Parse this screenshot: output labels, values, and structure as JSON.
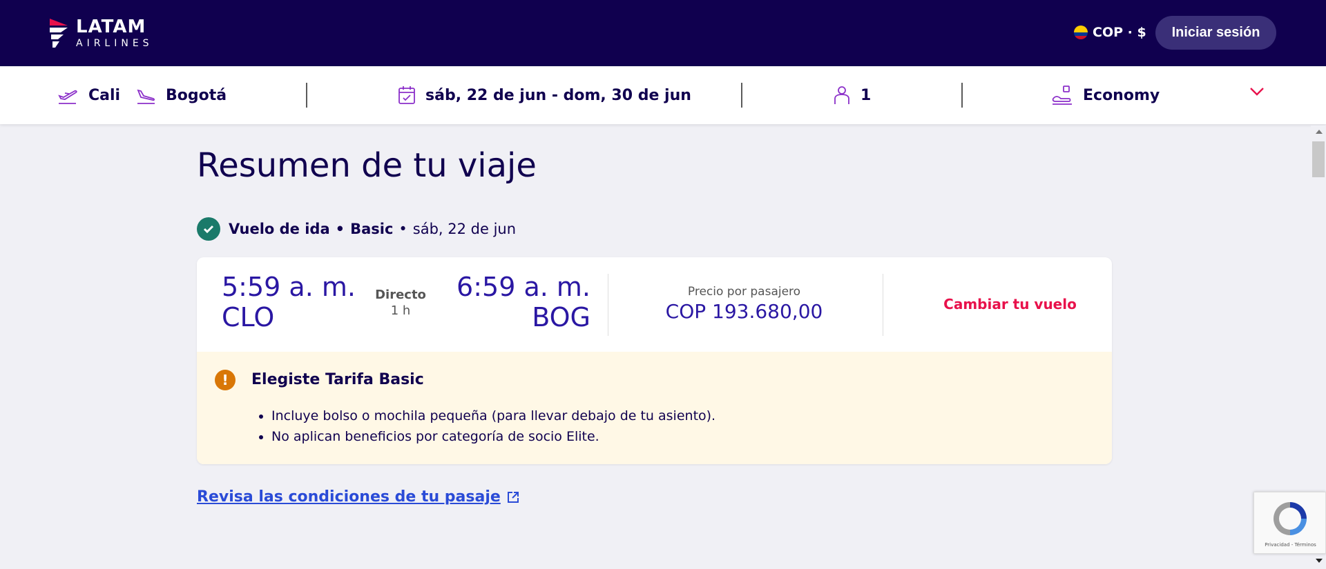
{
  "header": {
    "logo_main": "LATAM",
    "logo_sub": "AIRLINES",
    "currency": "COP · $",
    "login_label": "Iniciar sesión"
  },
  "search": {
    "origin": "Cali",
    "destination": "Bogotá",
    "dates": "sáb, 22 de jun - dom, 30 de jun",
    "passengers": "1",
    "cabin": "Economy"
  },
  "main": {
    "title": "Resumen de tu viaje",
    "segment": {
      "label": "Vuelo de ida",
      "fare": "Basic",
      "date": "sáb, 22 de jun"
    },
    "flight": {
      "departure_time": "5:59 a. m.",
      "departure_code": "CLO",
      "stops": "Directo",
      "duration": "1 h",
      "arrival_time": "6:59 a. m.",
      "arrival_code": "BOG",
      "price_label": "Precio por pasajero",
      "price": "COP 193.680,00",
      "change_label": "Cambiar tu vuelo"
    },
    "notice": {
      "title": "Elegiste Tarifa Basic",
      "items": [
        "Incluye bolso o mochila pequeña (para llevar debajo de tu asiento).",
        "No aplican beneficios por categoría de socio Elite."
      ]
    },
    "conditions_link": "Revisa las condiciones de tu pasaje"
  },
  "recaptcha": {
    "text": "Privacidad - Términos"
  },
  "colors": {
    "header_bg": "#10004f",
    "accent": "#e8114b",
    "primary_text": "#2a17a3",
    "success": "#1b7a6a",
    "warning": "#d97706",
    "notice_bg": "#fff8e6",
    "link": "#2a4bd7"
  }
}
